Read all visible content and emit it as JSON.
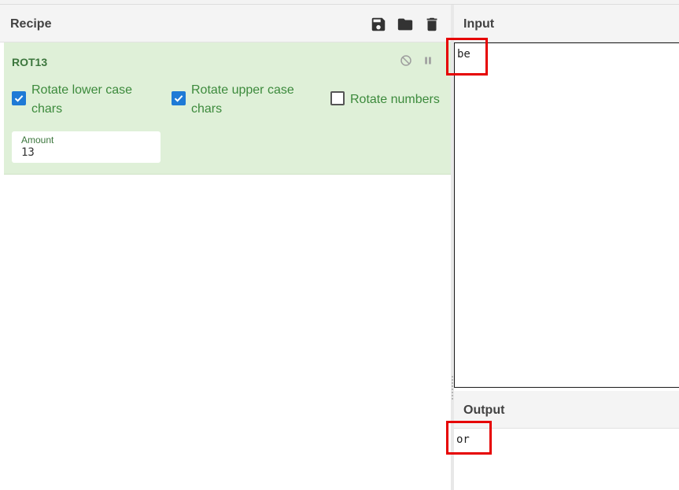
{
  "recipe": {
    "title": "Recipe",
    "icons": {
      "save": "save-icon",
      "load": "folder-icon",
      "clear": "trash-icon"
    },
    "operation": {
      "name": "ROT13",
      "icons": {
        "disable": "disable-icon",
        "breakpoint": "pause-icon"
      },
      "options": {
        "rotate_lower": {
          "label": "Rotate lower case chars",
          "checked": true
        },
        "rotate_upper": {
          "label": "Rotate upper case chars",
          "checked": true
        },
        "rotate_numbers": {
          "label": "Rotate numbers",
          "checked": false
        }
      },
      "amount": {
        "label": "Amount",
        "value": "13"
      }
    },
    "colors": {
      "op_background": "#dff0d8",
      "op_title": "#3c763d",
      "checkbox_on": "#1e7ad6"
    }
  },
  "input": {
    "title": "Input",
    "value": "be"
  },
  "output": {
    "title": "Output",
    "value": "or"
  },
  "highlight_color": "#e60000"
}
